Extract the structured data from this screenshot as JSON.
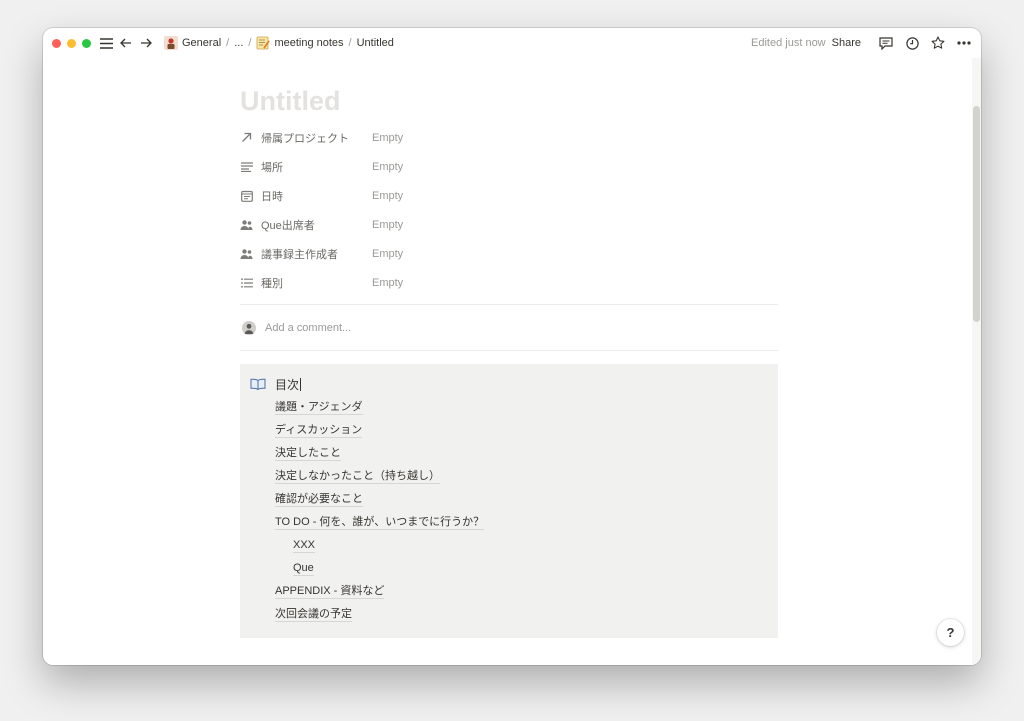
{
  "topbar": {
    "breadcrumbs": [
      {
        "label": "General",
        "icon": "workspace-emoji-icon"
      },
      {
        "label": "..."
      },
      {
        "label": "meeting notes",
        "icon": "memo-emoji-icon"
      },
      {
        "label": "Untitled"
      }
    ],
    "separator": "/",
    "edited_status": "Edited just now",
    "share_label": "Share"
  },
  "page": {
    "title": "Untitled",
    "properties": [
      {
        "name": "帰属プロジェクト",
        "value": "Empty",
        "icon": "relation-arrow-icon"
      },
      {
        "name": "場所",
        "value": "Empty",
        "icon": "text-lines-icon"
      },
      {
        "name": "日時",
        "value": "Empty",
        "icon": "calendar-icon"
      },
      {
        "name": "Que出席者",
        "value": "Empty",
        "icon": "people-icon"
      },
      {
        "name": "議事録主作成者",
        "value": "Empty",
        "icon": "people-icon"
      },
      {
        "name": "種別",
        "value": "Empty",
        "icon": "list-icon"
      }
    ],
    "comment_placeholder": "Add a comment...",
    "toc": {
      "heading": "目次",
      "items": [
        {
          "label": "議題・アジェンダ",
          "level": 1
        },
        {
          "label": "ディスカッション",
          "level": 1
        },
        {
          "label": "決定したこと",
          "level": 1
        },
        {
          "label": "決定しなかったこと（持ち越し）",
          "level": 1
        },
        {
          "label": "確認が必要なこと",
          "level": 1
        },
        {
          "label": "TO DO - 何を、誰が、いつまでに行うか？",
          "level": 1
        },
        {
          "label": "XXX",
          "level": 2
        },
        {
          "label": "Que",
          "level": 2
        },
        {
          "label": "APPENDIX - 資料など",
          "level": 1
        },
        {
          "label": "次回会議の予定",
          "level": 1
        }
      ]
    }
  },
  "help_label": "?",
  "colors": {
    "accent_text": "#37352f",
    "muted_text": "#9b9a97",
    "callout_bg": "#f1f1ef",
    "title_placeholder": "#e3e2df"
  }
}
